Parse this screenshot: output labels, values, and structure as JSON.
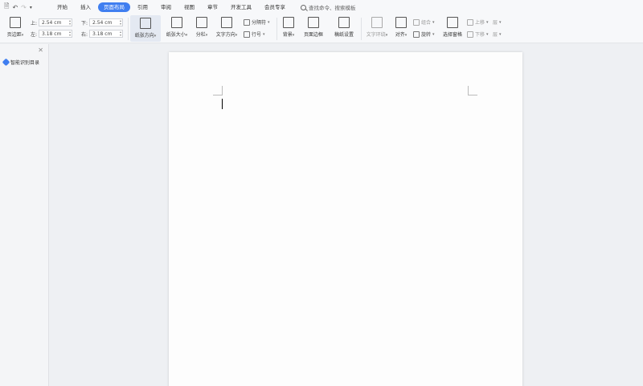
{
  "quick_access": {
    "icons": [
      "document-icon",
      "undo-icon",
      "redo-icon",
      "dropdown-icon"
    ]
  },
  "menu": {
    "tabs": [
      "开始",
      "插入",
      "页面布局",
      "引用",
      "审阅",
      "视图",
      "章节",
      "开发工具",
      "会员专享"
    ],
    "active_tab": "页面布局",
    "search_placeholder": "查找命令、搜索模板"
  },
  "ribbon": {
    "margins_label": "页边距",
    "top_label": "上:",
    "top_value": "2.54 cm",
    "bottom_label": "下:",
    "bottom_value": "2.54 cm",
    "left_label": "左:",
    "left_value": "3.18 cm",
    "right_label": "右:",
    "right_value": "3.18 cm",
    "orientation_label": "纸张方向",
    "size_label": "纸张大小",
    "columns_label": "分栏",
    "text_direction_label": "文字方向",
    "separator_label": "分隔符",
    "line_numbers_label": "行号",
    "background_label": "背景",
    "page_border_label": "页面边框",
    "manuscript_label": "稿纸设置",
    "text_wrap_label": "文字环绕",
    "align_label": "对齐",
    "group_label": "组合",
    "rotate_label": "旋转",
    "selection_pane_label": "选择窗格",
    "bring_forward_label": "上移",
    "send_backward_label": "下移",
    "layer_label": "层"
  },
  "side_panel": {
    "nav_label": "智能识别目录"
  },
  "colors": {
    "accent": "#3f7ef0",
    "ribbon_bg": "#f7f8fa",
    "doc_bg": "#eef0f3"
  }
}
